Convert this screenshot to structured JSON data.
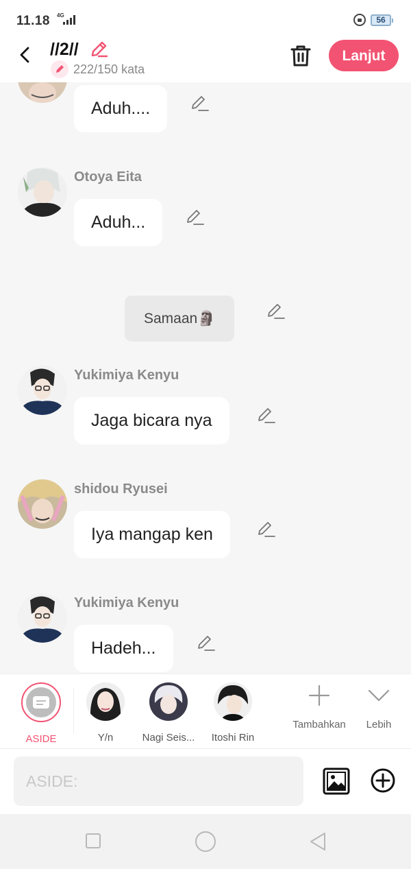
{
  "status_bar": {
    "time": "11.18",
    "network": "4G",
    "battery": "56"
  },
  "header": {
    "title": "//2//",
    "word_count": "222/150 kata",
    "next_label": "Lanjut"
  },
  "messages": [
    {
      "name": "",
      "text": "Aduh...."
    },
    {
      "name": "Otoya Eita",
      "text": "Aduh..."
    },
    {
      "type": "aside",
      "text": "Samaan🗿"
    },
    {
      "name": "Yukimiya Kenyu",
      "text": "Jaga bicara nya"
    },
    {
      "name": "shidou Ryusei",
      "text": "Iya mangap ken"
    },
    {
      "name": "Yukimiya Kenyu",
      "text": "Hadeh..."
    }
  ],
  "characters": [
    {
      "label": "ASIDE",
      "selected": true
    },
    {
      "label": "Y/n"
    },
    {
      "label": "Nagi Seis..."
    },
    {
      "label": "Itoshi Rin"
    }
  ],
  "tools": {
    "add_label": "Tambahkan",
    "more_label": "Lebih"
  },
  "composer": {
    "placeholder": "ASIDE:"
  },
  "colors": {
    "accent": "#f25372",
    "background": "#f6f6f6",
    "bubble": "#ffffff",
    "aside_bubble": "#e9e9e9"
  },
  "icons": [
    "back-icon",
    "pencil-icon",
    "trash-icon",
    "edit-icon",
    "plus-icon",
    "chevron-down-icon",
    "image-icon",
    "add-circle-icon"
  ]
}
